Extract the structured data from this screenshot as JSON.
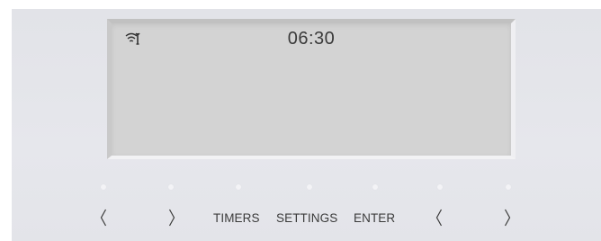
{
  "display": {
    "clock": "06:30",
    "status_icon": "wifi-wrench-icon"
  },
  "buttons": {
    "left_1": {
      "icon": "chevron-left-icon"
    },
    "right_1": {
      "icon": "chevron-right-icon"
    },
    "timers": "TIMERS",
    "settings": "SETTINGS",
    "enter": "ENTER",
    "left_2": {
      "icon": "chevron-left-icon"
    },
    "right_2": {
      "icon": "chevron-right-icon"
    }
  },
  "colors": {
    "panel": "#e4e5ea",
    "screen": "#d3d3d3",
    "text": "#3b3b3b"
  }
}
